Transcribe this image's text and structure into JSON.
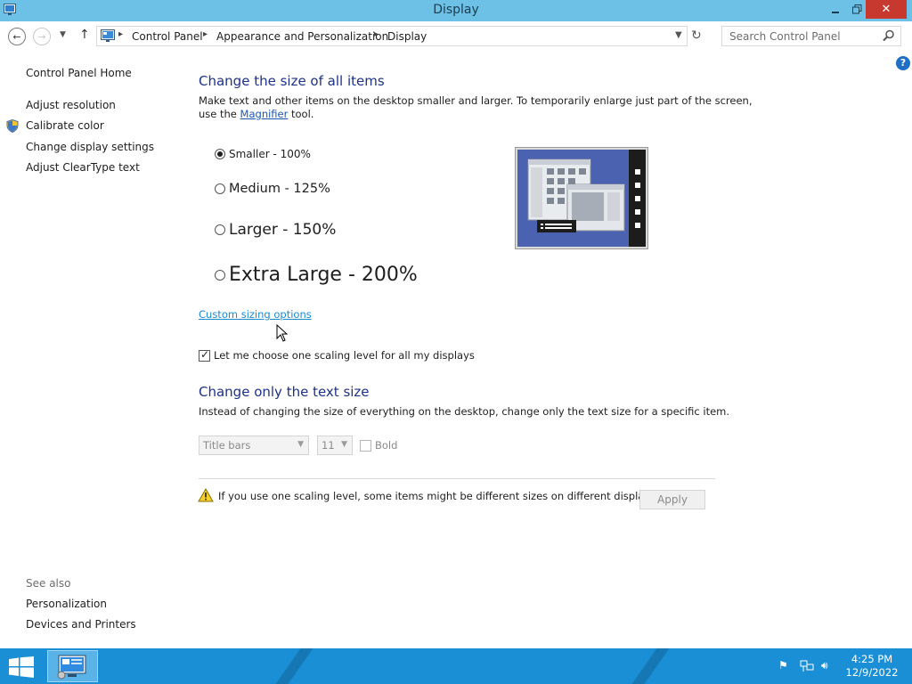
{
  "window": {
    "title": "Display"
  },
  "address_bar": {
    "crumbs": [
      "Control Panel",
      "Appearance and Personalization",
      "Display"
    ],
    "search_placeholder": "Search Control Panel"
  },
  "left_pane": {
    "home": "Control Panel Home",
    "links": [
      "Adjust resolution",
      "Calibrate color",
      "Change display settings",
      "Adjust ClearType text"
    ],
    "see_also_label": "See also",
    "see_also": [
      "Personalization",
      "Devices and Printers"
    ]
  },
  "main": {
    "heading1": "Change the size of all items",
    "desc1_line1": "Make text and other items on the desktop smaller and larger. To temporarily enlarge just part of the screen,",
    "desc1_line2_pre": "use the ",
    "desc1_link": "Magnifier",
    "desc1_line2_post": " tool.",
    "options": [
      {
        "label": "Smaller - 100%",
        "selected": true
      },
      {
        "label": "Medium - 125%",
        "selected": false
      },
      {
        "label": "Larger - 150%",
        "selected": false
      },
      {
        "label": "Extra Large - 200%",
        "selected": false
      }
    ],
    "custom_link": "Custom sizing options",
    "checkbox_label": "Let me choose one scaling level for all my displays",
    "checkbox_checked": true,
    "heading2": "Change only the text size",
    "desc2": "Instead of changing the size of everything on the desktop, change only the text size for a specific item.",
    "item_select": "Title bars",
    "size_select": "11",
    "bold_label": "Bold",
    "warning": "If you use one scaling level, some items might be different sizes on different displays.",
    "apply_label": "Apply"
  },
  "taskbar": {
    "time": "4:25 PM",
    "date": "12/9/2022"
  }
}
